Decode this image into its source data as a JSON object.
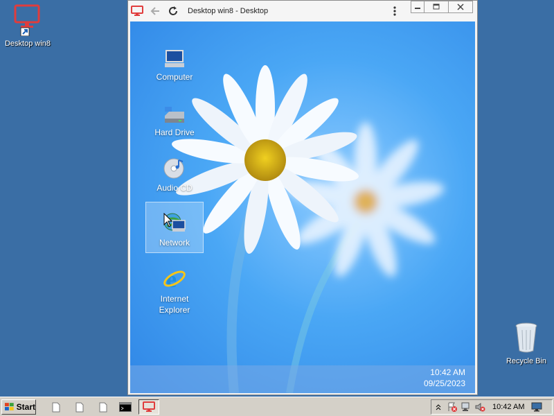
{
  "host": {
    "desktop_icons": {
      "shortcut_label": "Desktop win8",
      "recycle_label": "Recycle Bin"
    },
    "taskbar": {
      "start_label": "Start",
      "clock": "10:42 AM"
    }
  },
  "window": {
    "title": "Desktop win8 - Desktop"
  },
  "remote": {
    "icons": [
      {
        "label": "Computer"
      },
      {
        "label": "Hard Drive"
      },
      {
        "label": "Audio CD"
      },
      {
        "label": "Network"
      },
      {
        "label": "Internet Explorer"
      }
    ],
    "clock_time": "10:42 AM",
    "clock_date": "09/25/2023"
  },
  "colors": {
    "host_background": "#3a6ea5",
    "accent_red": "#e03c3c",
    "wallpaper_blue": "#2f86e6"
  }
}
